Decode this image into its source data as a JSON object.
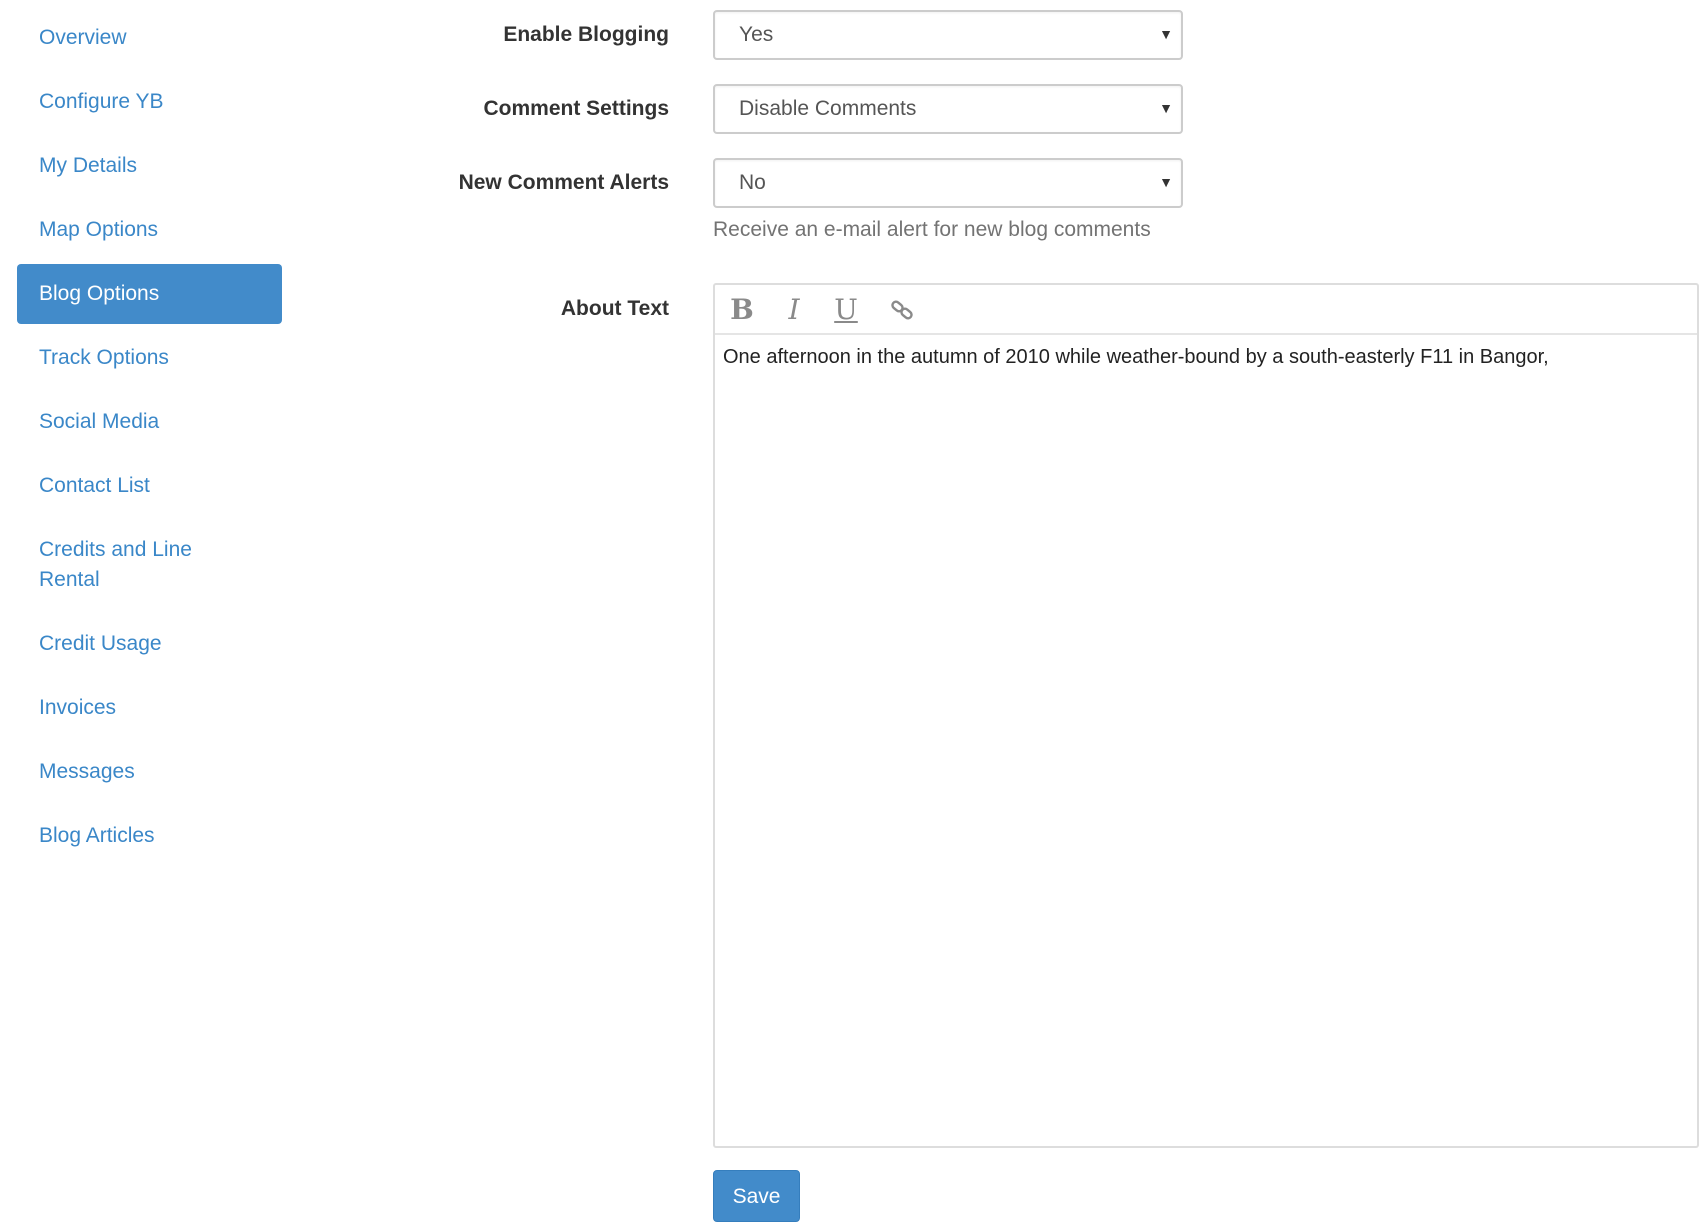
{
  "sidebar": {
    "items": [
      {
        "label": "Overview",
        "active": false
      },
      {
        "label": "Configure YB",
        "active": false
      },
      {
        "label": "My Details",
        "active": false
      },
      {
        "label": "Map Options",
        "active": false
      },
      {
        "label": "Blog Options",
        "active": true
      },
      {
        "label": "Track Options",
        "active": false
      },
      {
        "label": "Social Media",
        "active": false
      },
      {
        "label": "Contact List",
        "active": false
      },
      {
        "label": "Credits and Line Rental",
        "active": false
      },
      {
        "label": "Credit Usage",
        "active": false
      },
      {
        "label": "Invoices",
        "active": false
      },
      {
        "label": "Messages",
        "active": false
      },
      {
        "label": "Blog Articles",
        "active": false
      }
    ]
  },
  "form": {
    "enable_blogging": {
      "label": "Enable Blogging",
      "value": "Yes"
    },
    "comment_settings": {
      "label": "Comment Settings",
      "value": "Disable Comments"
    },
    "new_comment_alerts": {
      "label": "New Comment Alerts",
      "value": "No",
      "help": "Receive an e-mail alert for new blog comments"
    },
    "about_text": {
      "label": "About Text",
      "content": "One afternoon in the autumn of 2010 while weather-bound by a south-easterly F11 in Bangor,"
    },
    "save_label": "Save"
  },
  "editor_toolbar": {
    "bold": "B",
    "italic": "I",
    "underline": "U",
    "link_icon": "link-icon"
  },
  "colors": {
    "accent": "#428bca",
    "link": "#3a87c8"
  }
}
